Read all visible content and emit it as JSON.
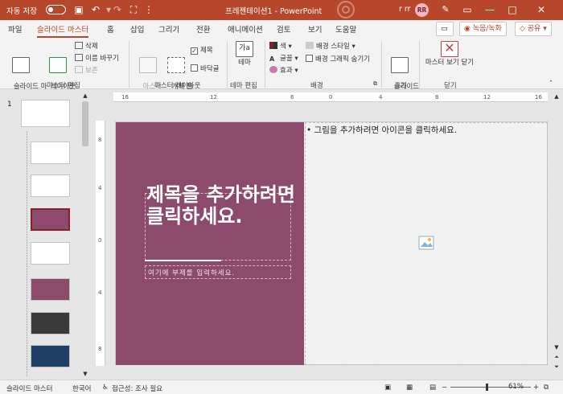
{
  "titlebar": {
    "autosave_label": "자동 저장",
    "autosave_state": "끔",
    "document_title": "프레젠테이션1 - PowerPoint",
    "user_name": "r rr",
    "avatar_initials": "RR",
    "accent_color": "#b7472a"
  },
  "menu": {
    "tabs": [
      "파일",
      "슬라이드 마스터",
      "홈",
      "삽입",
      "그리기",
      "전환",
      "애니메이션",
      "검토",
      "보기",
      "도움말"
    ],
    "active_tab": "슬라이드 마스터",
    "record_label": "◉ 녹음/녹화",
    "share_label": "◇ 공유 ▾"
  },
  "ribbon": {
    "groups": {
      "master_edit": {
        "label": "마스터 편집",
        "insert_master": "슬라이드 마\n스터 삽입",
        "insert_layout": "레이아웃\n삽입",
        "delete": "삭제",
        "rename": "이름 바꾸기",
        "preserve": "보존"
      },
      "master_layout": {
        "label": "마스터 레이아웃",
        "master_layout_btn": "마스터\n레이아웃",
        "insert_placeholder": "개체 틀\n삽입",
        "title_check": "제목",
        "title_checked": true,
        "footer_check": "바닥글",
        "footer_checked": false
      },
      "edit_theme": {
        "label": "테마 편집",
        "themes_btn": "테마"
      },
      "background": {
        "label": "배경",
        "colors": "색",
        "fonts": "글꼴",
        "effects": "효과",
        "bg_styles": "배경 스타일",
        "hide_bg": "배경 그래픽 숨기기",
        "hide_bg_checked": false
      },
      "size": {
        "label": "크기",
        "slide_size": "슬라이드\n크기"
      },
      "close": {
        "label": "닫기",
        "close_master": "마스터 보기 닫기"
      }
    }
  },
  "thumbnails": {
    "first_number": "1",
    "selected_index": 3,
    "colors": [
      "#ffffff",
      "#ffffff",
      "#ffffff",
      "#8c4a6c",
      "#ffffff",
      "#8c4a6c",
      "#3a3a3a",
      "#1f3f66"
    ]
  },
  "slide": {
    "title_placeholder": "제목을 추가하려면 클릭하세요.",
    "subtitle_placeholder": "여기에 부제를 입력하세요.",
    "content_placeholder": "• 그림을 추가하려면 아이콘을 클릭하세요.",
    "left_panel_color": "#8c4a6c"
  },
  "statusbar": {
    "view_label": "슬라이드 마스터",
    "language": "한국어",
    "accessibility": "접근성: 조사 필요",
    "zoom": "61%"
  }
}
